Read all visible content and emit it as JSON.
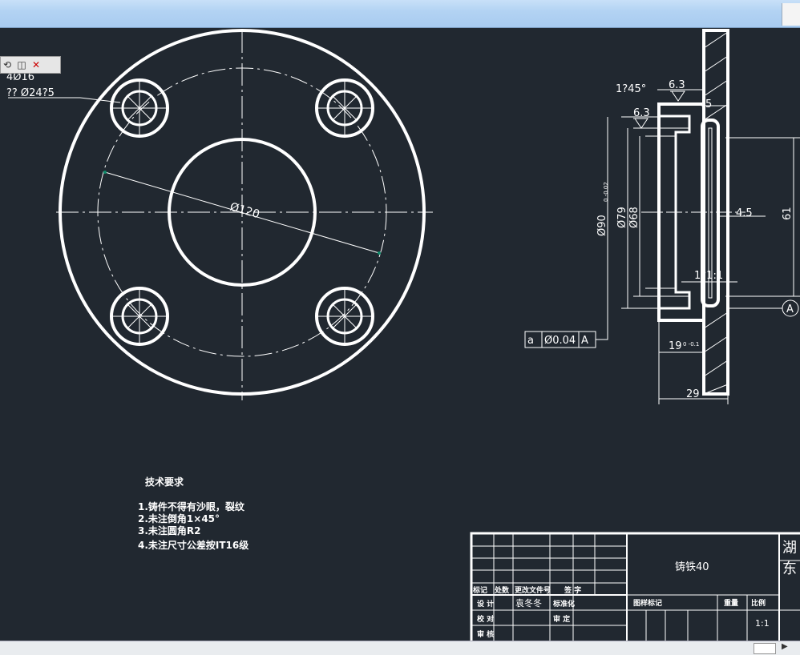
{
  "title_bar": {
    "text": ""
  },
  "toolbar": {
    "icons": [
      "orbit-icon",
      "view-cube-icon",
      "close-x-icon"
    ]
  },
  "front_view": {
    "hole_count_label": "4Ø16",
    "hole_note_label": "?? Ø24?5",
    "pcd_label": "Ø120"
  },
  "section_view": {
    "chamfer_label": "1?45°",
    "roughness_top": "6.3",
    "roughness_side": "6.3",
    "dim_5": "5",
    "dim_d90": "Ø90",
    "dim_d90_tol": "0 -0.02",
    "dim_d79": "Ø79",
    "dim_d68": "Ø68",
    "dim_4_5": "4.5",
    "dim_61": "61",
    "dim_1x1": "1?1:1",
    "datum": "A",
    "tolerance_symbol": "a",
    "tolerance_value": "Ø0.04",
    "tolerance_datum": "A",
    "dim_19": "19",
    "dim_19_tol": "0 -0.1",
    "dim_29": "29"
  },
  "tech_requirements": {
    "heading": "技术要求",
    "items": [
      "1.铸件不得有沙眼，裂纹",
      "2.未注倒角1×45°",
      "3.未注圆角R2",
      "4.未注尺寸公差按IT16级"
    ]
  },
  "title_block": {
    "material": "铸铁40",
    "col_mark": "标记",
    "col_count": "处数",
    "col_change_doc": "更改文件号",
    "col_sign": "签 字",
    "designer_label": "设 计",
    "designer_name": "袁冬冬",
    "standardize_label": "标准化",
    "check_label": "校 对",
    "approve_label": "审 定",
    "review_label": "审 核",
    "drawing_mark_label": "图样标记",
    "weight_label": "重量",
    "scale_label": "比例",
    "scale_value": "1:1",
    "company_line1": "湖",
    "company_line2": "东"
  },
  "colors": {
    "background": "#212830",
    "lines": "#ffffff"
  }
}
